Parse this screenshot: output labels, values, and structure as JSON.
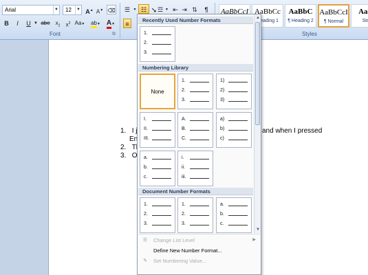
{
  "ribbon": {
    "font_name": "Arial",
    "font_size": "12",
    "grow_font": "A",
    "shrink_font": "A",
    "clear_format": "",
    "bold": "B",
    "italic": "I",
    "underline": "U",
    "strike": "abe",
    "subscript": "x",
    "superscript": "x",
    "change_case": "Aa",
    "highlight": "ab",
    "font_color": "A",
    "sort": "",
    "pilcrow": "¶",
    "font_group_label": "Font",
    "styles_group_label": "Styles"
  },
  "styles": [
    {
      "sample": "AaBbCcI",
      "name": "",
      "selected": false
    },
    {
      "sample": "AaBbCc",
      "name": "Heading 1",
      "selected": false
    },
    {
      "sample": "AaBbC",
      "name": "¶ Heading 2",
      "selected": false
    },
    {
      "sample": "AaBbCcI",
      "name": "¶ Normal",
      "selected": true
    },
    {
      "sample": "AaBl",
      "name": "Stro",
      "selected": false
    }
  ],
  "document": {
    "lines": [
      {
        "num": "1.",
        "text": "I ju",
        "tail": "and when I pressed"
      },
      {
        "num": "",
        "text": "Ent",
        "tail": ""
      },
      {
        "num": "2.",
        "text": "The",
        "tail": ""
      },
      {
        "num": "3.",
        "text": "Ok",
        "tail": ""
      }
    ]
  },
  "dropdown": {
    "recent_header": "Recently Used Number Formats",
    "library_header": "Numbering Library",
    "document_header": "Document Number Formats",
    "none_label": "None",
    "recent": [
      [
        "1.",
        "2.",
        "3."
      ]
    ],
    "library": [
      [
        "1.",
        "2.",
        "3."
      ],
      [
        "1)",
        "2)",
        "3)"
      ],
      [
        "I.",
        "II.",
        "III."
      ],
      [
        "A.",
        "B.",
        "C."
      ],
      [
        "a)",
        "b)",
        "c)"
      ],
      [
        "a.",
        "b.",
        "c."
      ],
      [
        "i.",
        "ii.",
        "iii."
      ]
    ],
    "document_formats": [
      [
        "1.",
        "2.",
        "3."
      ],
      [
        "1.",
        "2.",
        "3."
      ],
      [
        "a.",
        "b.",
        "c."
      ]
    ],
    "menu": {
      "change_list_level": "Change List Level",
      "define_new": "Define New Number Format...",
      "set_value": "Set Numbering Value..."
    }
  },
  "colors": {
    "selected_border": "#e8a437",
    "ribbon_top": "#eaf1fb",
    "accent_text": "#1f3b76"
  }
}
